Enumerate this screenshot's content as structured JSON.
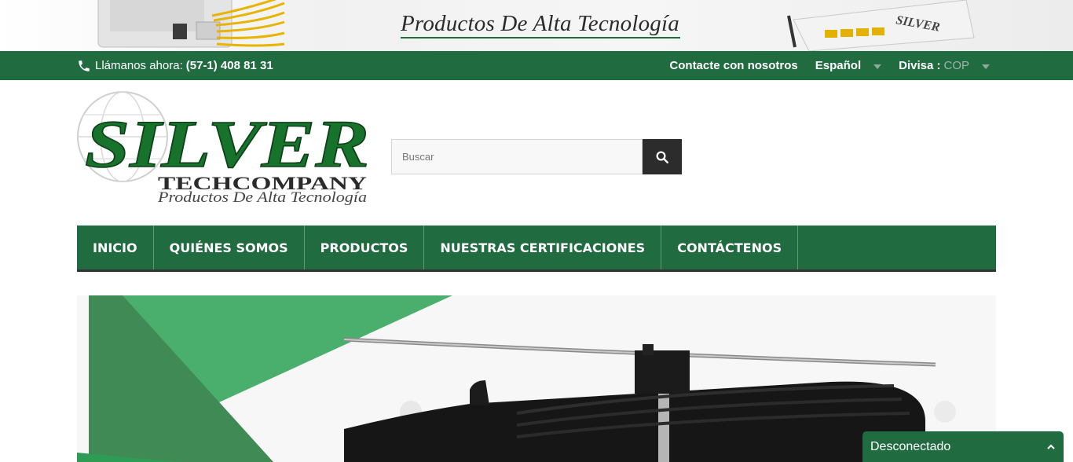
{
  "banner": {
    "tagline": "Productos De Alta Tecnología",
    "device_brand": "SILVER"
  },
  "topbar": {
    "call_label": "Llámanos ahora:",
    "phone_number": "(57-1) 408 81 31",
    "contact_link": "Contacte con nosotros",
    "language": "Español",
    "currency_label": "Divisa :",
    "currency_value": "COP"
  },
  "logo": {
    "brand": "SILVER",
    "sub": "TECHCOMPANY",
    "tagline": "Productos De Alta Tecnología"
  },
  "search": {
    "placeholder": "Buscar"
  },
  "nav": {
    "items": [
      {
        "label": "INICIO"
      },
      {
        "label": "QUIÉNES SOMOS"
      },
      {
        "label": "PRODUCTOS"
      },
      {
        "label": "NUESTRAS CERTIFICACIONES"
      },
      {
        "label": "CONTÁCTENOS"
      }
    ]
  },
  "chat": {
    "status": "Desconectado"
  },
  "colors": {
    "brand_green": "#206b40",
    "dark": "#2c2c2c"
  }
}
